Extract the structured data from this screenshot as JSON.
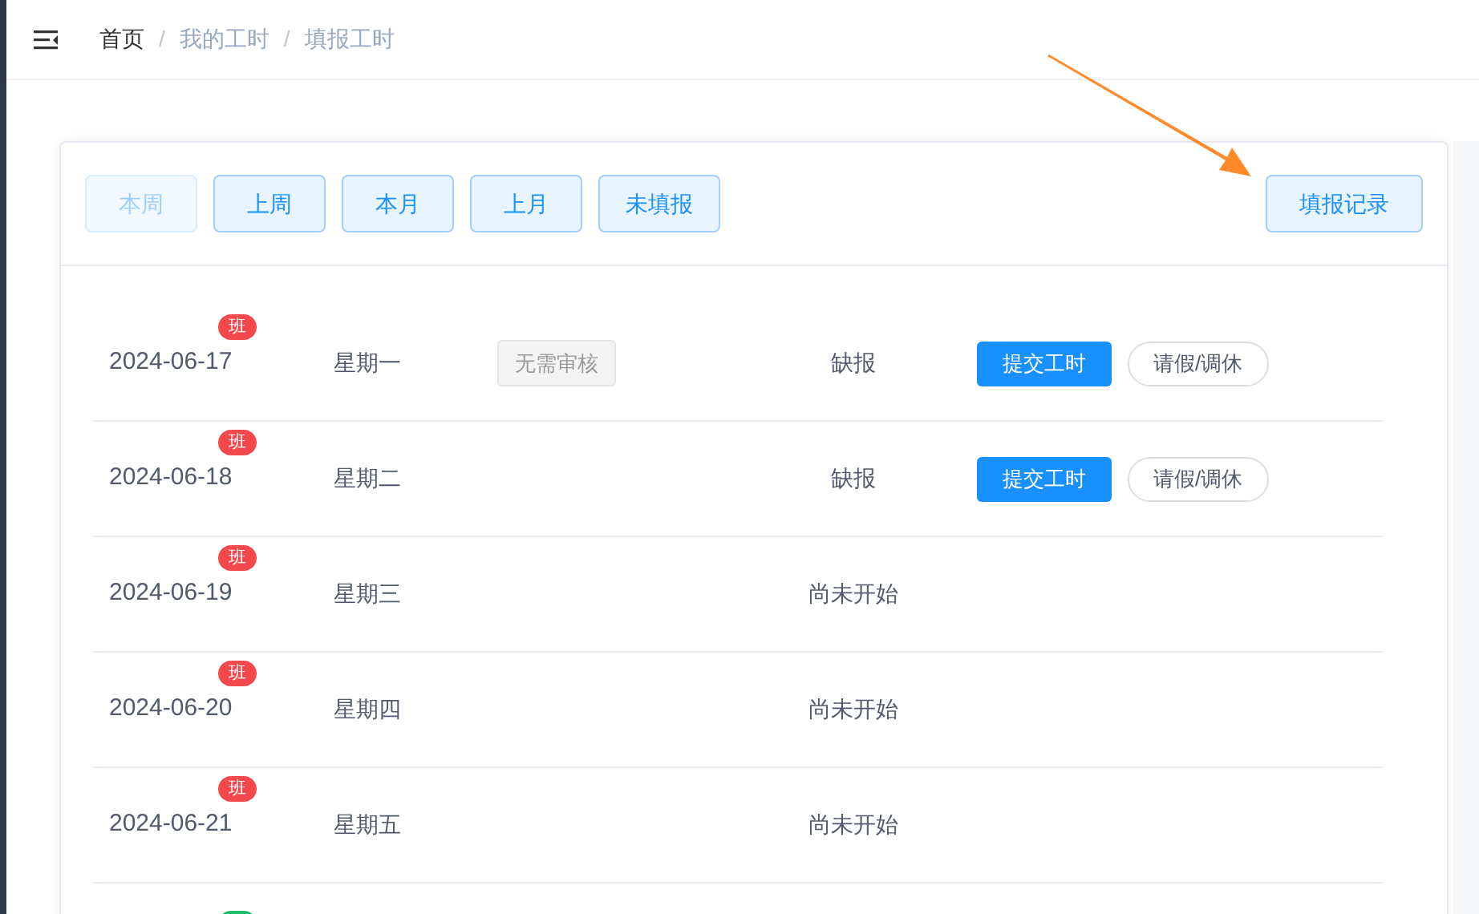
{
  "breadcrumb": [
    {
      "label": "首页",
      "current": true
    },
    {
      "label": "我的工时",
      "current": false
    },
    {
      "label": "填报工时",
      "current": false
    }
  ],
  "breadcrumb_separator": "/",
  "filters": [
    {
      "label": "本周",
      "disabled": true
    },
    {
      "label": "上周",
      "disabled": false
    },
    {
      "label": "本月",
      "disabled": false
    },
    {
      "label": "上月",
      "disabled": false
    },
    {
      "label": "未填报",
      "disabled": false
    }
  ],
  "record_button": "填报记录",
  "rows": [
    {
      "date": "2024-06-17",
      "badge": {
        "text": "班",
        "color": "#f5484b"
      },
      "weekday": "星期一",
      "review_tag": "无需审核",
      "status": "缺报",
      "actions": [
        "提交工时",
        "请假/调休"
      ]
    },
    {
      "date": "2024-06-18",
      "badge": {
        "text": "班",
        "color": "#f5484b"
      },
      "weekday": "星期二",
      "status": "缺报",
      "actions": [
        "提交工时",
        "请假/调休"
      ]
    },
    {
      "date": "2024-06-19",
      "badge": {
        "text": "班",
        "color": "#f5484b"
      },
      "weekday": "星期三",
      "status": "尚未开始"
    },
    {
      "date": "2024-06-20",
      "badge": {
        "text": "班",
        "color": "#f5484b"
      },
      "weekday": "星期四",
      "status": "尚未开始"
    },
    {
      "date": "2024-06-21",
      "badge": {
        "text": "班",
        "color": "#f5484b"
      },
      "weekday": "星期五",
      "status": "尚未开始"
    },
    {
      "badge": {
        "color": "#19be6b"
      }
    }
  ]
}
